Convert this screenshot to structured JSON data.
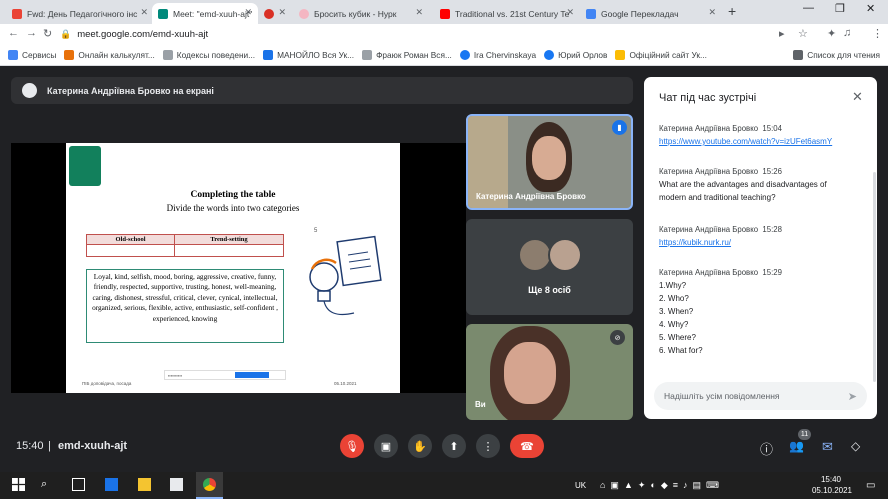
{
  "tabs": [
    {
      "title": "Fwd: День Педагогічного інс",
      "color": "#ea4335"
    },
    {
      "title": "Meet: \"emd-xuuh-ajt\"",
      "color": "#00897b"
    },
    {
      "title": "",
      "color": "#d93025"
    },
    {
      "title": "Бросить кубик - Нурк",
      "color": "#f4b6c2"
    },
    {
      "title": "Traditional vs. 21st Century Te",
      "color": "#ff0000"
    },
    {
      "title": "Google Перекладач",
      "color": "#4285f4"
    }
  ],
  "address": {
    "url": "meet.google.com/emd-xuuh-ajt"
  },
  "bookmarks": [
    {
      "label": "Сервисы",
      "color": "#4285f4"
    },
    {
      "label": "Онлайн калькулят...",
      "color": "#e8710a"
    },
    {
      "label": "Кодексы поведени...",
      "color": "#9aa0a6"
    },
    {
      "label": "МАНОЙЛО Вся Ук...",
      "color": "#1a73e8"
    },
    {
      "label": "Фраюк Роман Вся...",
      "color": "#9aa0a6"
    },
    {
      "label": "Ira Chervinskaya",
      "color": "#1877f2"
    },
    {
      "label": "Юрий Орлов",
      "color": "#1877f2"
    },
    {
      "label": "Офіційний сайт Ук...",
      "color": "#fbbc04"
    }
  ],
  "reading_list": "Список для чтения",
  "presenter_label": "Катерина Андріївна Бровко на екрані",
  "slide": {
    "title": "Completing the table",
    "subtitle": "Divide the words into two categories",
    "col1": "Old-school",
    "col2": "Trend-setting",
    "words": "Loyal, kind, selfish, mood, boring, aggressive, creative, funny, friendly, respected, supportive, trusting, honest, well-meaning, caring, dishonest, stressful, critical, clever, cynical, intellectual, organized, serious, flexible, active, enthusiastic, self-confident , experienced, knowing",
    "footer_left": "ПІБ доповідача, посада",
    "footer_right": "05.10.2021",
    "page_num": "5"
  },
  "tiles": {
    "speaker": "Катерина Андріївна Бровко",
    "others": "Ще 8 осіб",
    "self": "Ви"
  },
  "chat": {
    "title": "Чат під час зустрічі",
    "placeholder": "Надішліть усім повідомлення",
    "messages": [
      {
        "author": "Катерина Андріївна Бровко",
        "time": "15:04",
        "lines": [
          "https://www.youtube.com/watch?v=izUFet6asmY"
        ],
        "link": true
      },
      {
        "author": "Катерина Андріївна Бровко",
        "time": "15:26",
        "lines": [
          "What are the advantages and disadvantages of",
          "modern and traditional teaching?"
        ],
        "link": false
      },
      {
        "author": "Катерина Андріївна Бровко",
        "time": "15:28",
        "lines": [
          "https://kubik.nurk.ru/"
        ],
        "link": true
      },
      {
        "author": "Катерина Андріївна Бровко",
        "time": "15:29",
        "lines": [
          "1.Why?",
          "2. Who?",
          "3. When?",
          "4. Why?",
          "5. Where?",
          "6. What for?"
        ],
        "link": false
      }
    ]
  },
  "meeting": {
    "time": "15:40",
    "code": "emd-xuuh-ajt",
    "participants": "11"
  },
  "taskbar": {
    "lang": "UK",
    "time": "15:40",
    "date": "05.10.2021"
  }
}
